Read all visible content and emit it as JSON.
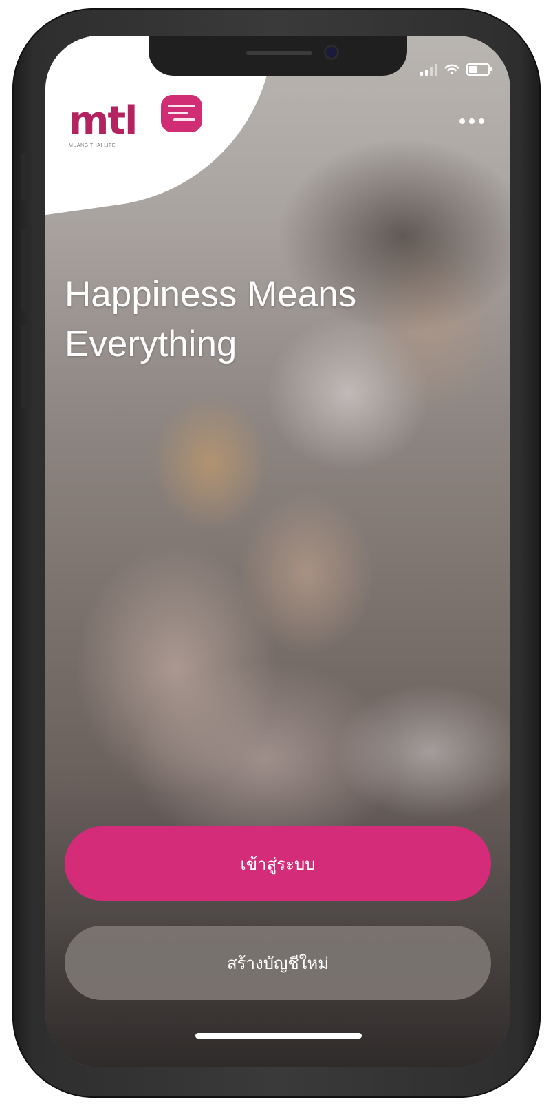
{
  "brand": {
    "logo_text": "mtl",
    "logo_subtext": "MUANG THAI LIFE",
    "accent_color": "#d42c79"
  },
  "status_bar": {
    "icons": [
      "cellular-signal-icon",
      "wifi-icon",
      "battery-icon"
    ]
  },
  "header": {
    "menu_icon": "more-horizontal-icon"
  },
  "hero": {
    "headline_line1": "Happiness Means",
    "headline_line2": "Everything"
  },
  "actions": {
    "login_label": "เข้าสู่ระบบ",
    "register_label": "สร้างบัญชีใหม่"
  }
}
